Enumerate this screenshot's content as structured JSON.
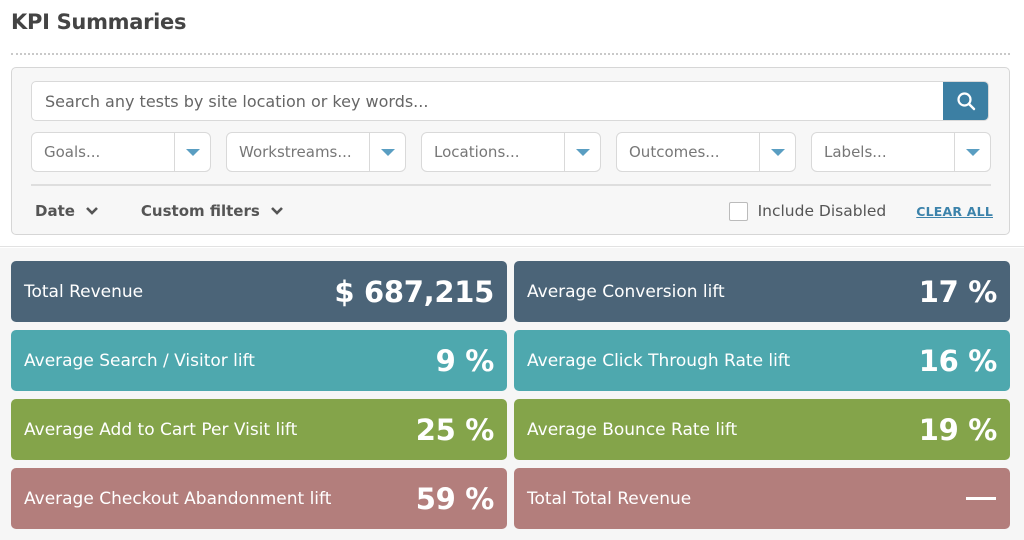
{
  "header": {
    "title": "KPI Summaries"
  },
  "search": {
    "placeholder": "Search any tests by site location or key words...",
    "value": "",
    "button_icon": "search-icon"
  },
  "filters": {
    "selects": [
      {
        "placeholder": "Goals...",
        "icon": "caret-down-icon"
      },
      {
        "placeholder": "Workstreams...",
        "icon": "caret-down-icon"
      },
      {
        "placeholder": "Locations...",
        "icon": "caret-down-icon"
      },
      {
        "placeholder": "Outcomes...",
        "icon": "caret-down-icon"
      },
      {
        "placeholder": "Labels...",
        "icon": "caret-down-icon"
      }
    ],
    "date_label": "Date",
    "custom_filters_label": "Custom filters",
    "include_disabled_label": "Include Disabled",
    "include_disabled_checked": false,
    "clear_all_label": "CLEAR ALL"
  },
  "colors": {
    "accent": "#3c7fa3",
    "slate": "#4b6478",
    "teal": "#4ea8ae",
    "green": "#84a44a",
    "rose": "#b37e7c"
  },
  "kpis": [
    {
      "label": "Total Revenue",
      "value": "$ 687,215",
      "color": "slate"
    },
    {
      "label": "Average Conversion lift",
      "value": "17 %",
      "color": "slate"
    },
    {
      "label": "Average Search / Visitor lift",
      "value": "9 %",
      "color": "teal"
    },
    {
      "label": "Average Click Through Rate lift",
      "value": "16 %",
      "color": "teal"
    },
    {
      "label": "Average Add to Cart Per Visit lift",
      "value": "25 %",
      "color": "green"
    },
    {
      "label": "Average Bounce Rate lift",
      "value": "19 %",
      "color": "green"
    },
    {
      "label": "Average Checkout Abandonment lift",
      "value": "59 %",
      "color": "rose"
    },
    {
      "label": "Total Total Revenue",
      "value": "—",
      "color": "rose"
    }
  ]
}
